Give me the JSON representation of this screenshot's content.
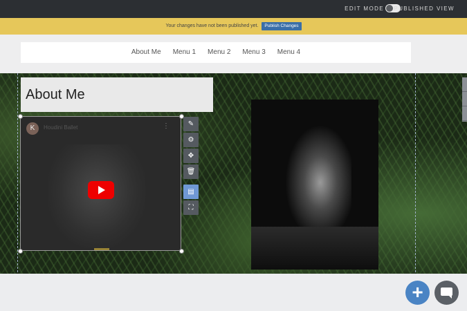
{
  "topbar": {
    "edit_mode": "EDIT MODE",
    "published_view": "PUBLISHED VIEW"
  },
  "notice": {
    "message": "Your changes have not been published yet.",
    "button": "Publish Changes"
  },
  "nav": {
    "items": [
      "About Me",
      "Menu 1",
      "Menu 2",
      "Menu 3",
      "Menu 4"
    ]
  },
  "section": {
    "title": "About Me"
  },
  "video": {
    "avatar_letter": "K",
    "title": "Houdini Ballet",
    "more": "⋮"
  },
  "toolbar": {
    "edit": "✎",
    "settings": "⚙",
    "move": "✥",
    "delete": "🗑",
    "layout": "▤",
    "expand": "⛶"
  },
  "fab": {
    "add": "+"
  },
  "colors": {
    "accent": "#4a84c4",
    "notice": "#e6c75a",
    "topbar": "#2c2f33"
  }
}
